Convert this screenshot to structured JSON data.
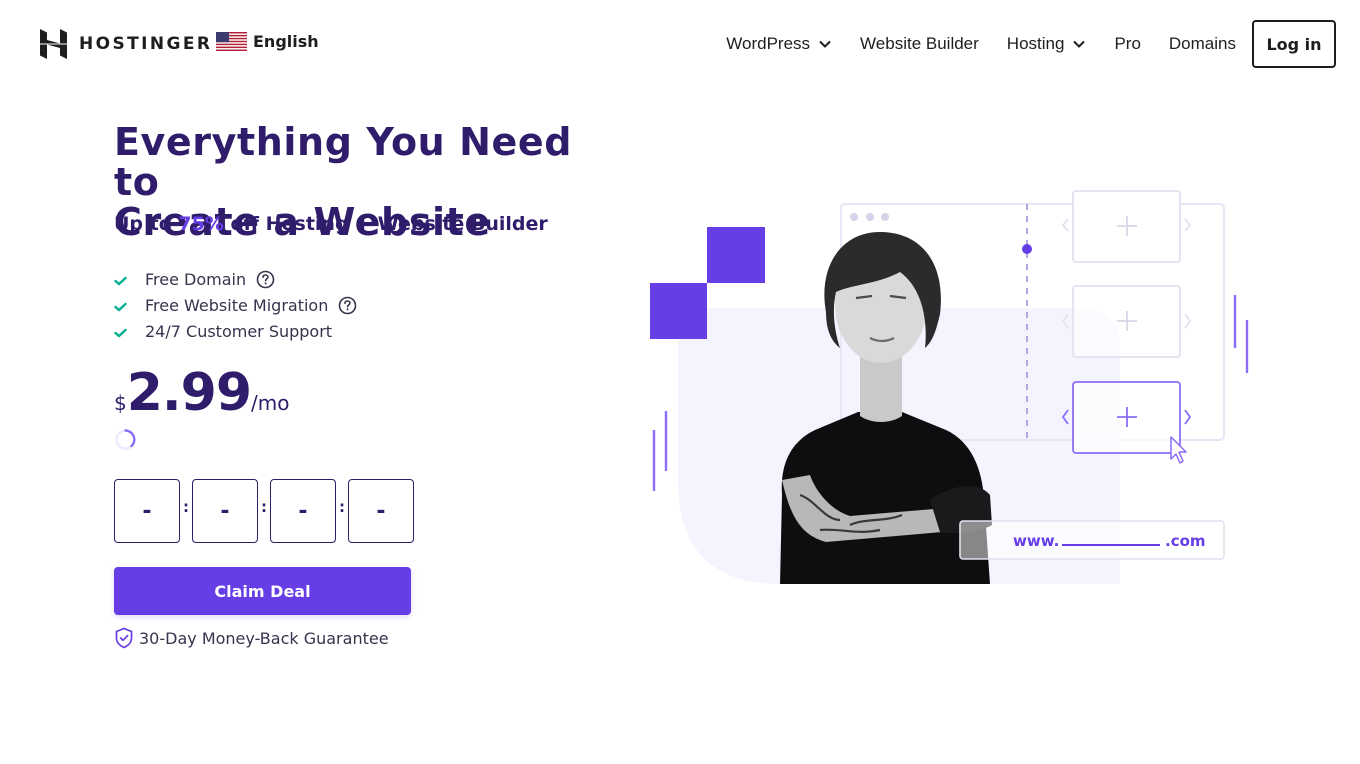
{
  "header": {
    "brand": "HOSTINGER",
    "language": {
      "label": "English",
      "flag_icon": "us-flag-icon"
    },
    "nav": [
      {
        "label": "WordPress",
        "has_dropdown": true
      },
      {
        "label": "Website Builder",
        "has_dropdown": false
      },
      {
        "label": "Hosting",
        "has_dropdown": true
      },
      {
        "label": "Pro",
        "has_dropdown": false
      },
      {
        "label": "Domains",
        "has_dropdown": false
      }
    ],
    "login_label": "Log in"
  },
  "hero": {
    "title_line1": "Everything You Need to",
    "title_line2": "Create a Website",
    "subtitle_prefix": "Up to ",
    "subtitle_discount": "75%",
    "subtitle_suffix": " off Hosting + Website Builder",
    "features": [
      {
        "label": "Free Domain",
        "has_help": true
      },
      {
        "label": "Free Website Migration",
        "has_help": true
      },
      {
        "label": "24/7 Customer Support",
        "has_help": false
      }
    ],
    "price": {
      "currency": "$",
      "amount": "2.99",
      "period": "/mo"
    },
    "loading": true,
    "countdown": [
      "-",
      "-",
      "-",
      "-"
    ],
    "countdown_separator": ":",
    "cta_label": "Claim Deal",
    "guarantee": "30-Day Money-Back Guarantee"
  },
  "illustration": {
    "domain_prefix": "www.",
    "domain_suffix": ".com"
  },
  "colors": {
    "brand_purple": "#673de6",
    "heading_navy": "#2f1c6a",
    "check_green": "#00b090",
    "illustration_bg": "#f4f4ff"
  }
}
